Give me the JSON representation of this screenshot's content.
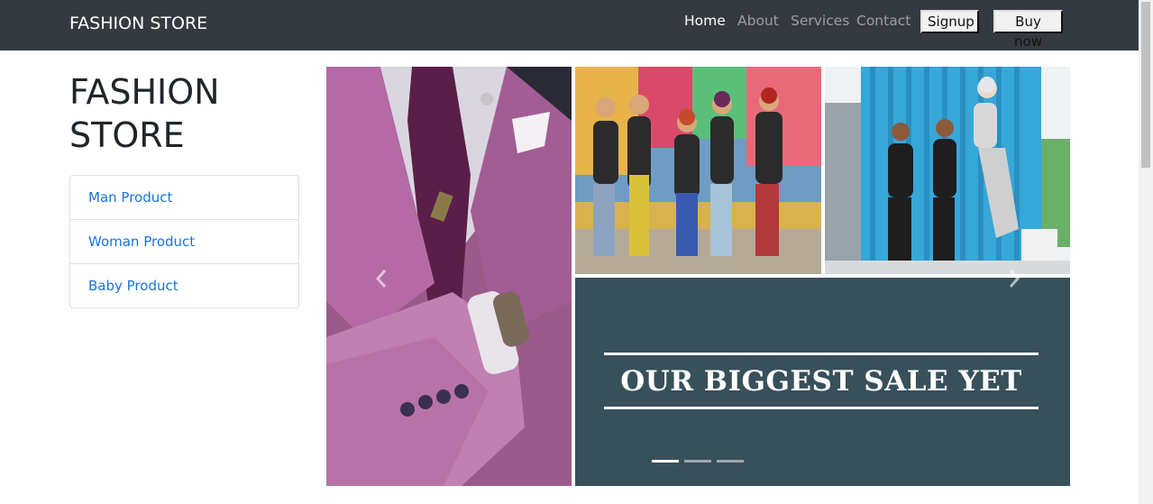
{
  "navbar": {
    "brand": "FASHION STORE",
    "links": [
      {
        "label": "Home",
        "active": true
      },
      {
        "label": "About",
        "active": false
      },
      {
        "label": "Services",
        "active": false
      },
      {
        "label": "Contact",
        "active": false
      }
    ],
    "buttons": {
      "signup": "Signup",
      "buy_now": "Buy now"
    },
    "background_color": "#343a40"
  },
  "sidebar": {
    "title": "FASHION STORE",
    "items": [
      {
        "label": "Man Product"
      },
      {
        "label": "Woman Product"
      },
      {
        "label": "Baby Product"
      }
    ],
    "link_color": "#1a73d9"
  },
  "carousel": {
    "sale_text": "OUR BIGGEST SALE YET",
    "sale_panel_color": "#38505a",
    "indicators": [
      {
        "active": true
      },
      {
        "active": false
      },
      {
        "active": false
      }
    ],
    "prev_icon": "chevron-left-icon",
    "next_icon": "chevron-right-icon"
  }
}
